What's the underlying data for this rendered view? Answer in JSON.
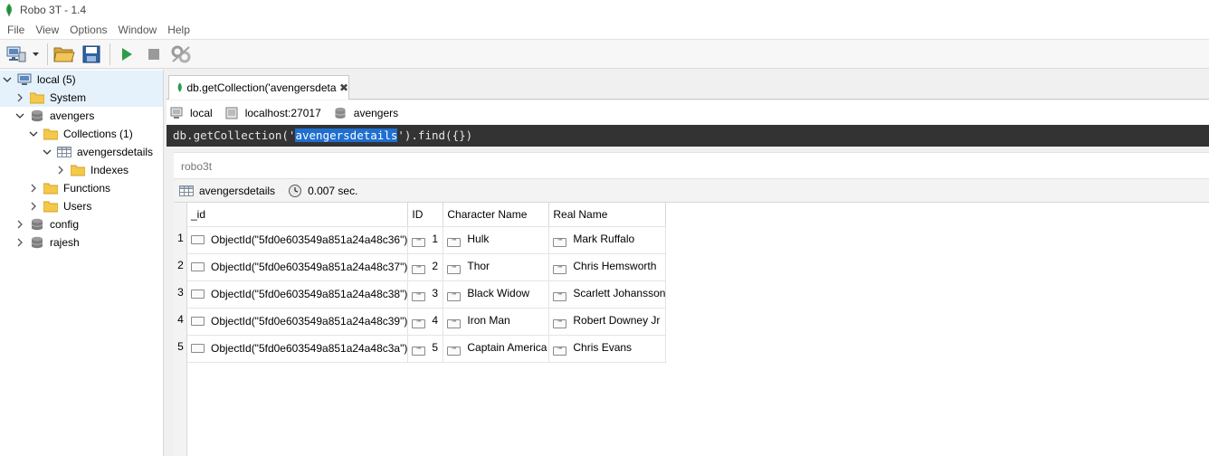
{
  "window": {
    "title": "Robo 3T - 1.4"
  },
  "menu": [
    "File",
    "View",
    "Options",
    "Window",
    "Help"
  ],
  "toolbar": {
    "buttons": [
      "connect-icon",
      "open-folder-icon",
      "save-icon",
      "play-icon",
      "stop-icon",
      "settings-icon"
    ]
  },
  "tree": {
    "connection": "local (5)",
    "items": [
      {
        "label": "System",
        "icon": "folder-icon"
      },
      {
        "label": "avengers",
        "icon": "database-icon"
      },
      {
        "label": "Collections (1)",
        "icon": "folder-icon"
      },
      {
        "label": "avengersdetails",
        "icon": "table-icon"
      },
      {
        "label": "Indexes",
        "icon": "folder-icon"
      },
      {
        "label": "Functions",
        "icon": "folder-icon"
      },
      {
        "label": "Users",
        "icon": "folder-icon"
      },
      {
        "label": "config",
        "icon": "database-icon"
      },
      {
        "label": "rajesh",
        "icon": "database-icon"
      }
    ]
  },
  "tab": {
    "label": "db.getCollection('avengersdetai...",
    "close": "✖"
  },
  "connection_bar": {
    "server": "local",
    "host": "localhost:27017",
    "database": "avengers"
  },
  "query": {
    "prefix": "db.getCollection('",
    "highlight": "avengersdetails",
    "suffix": "').find({})"
  },
  "result": {
    "title": "robo3t",
    "collection": "avengersdetails",
    "time": "0.007 sec."
  },
  "grid": {
    "columns": [
      "_id",
      "ID",
      "Character Name",
      "Real Name"
    ],
    "type_badge": "\"\"",
    "rows": [
      {
        "n": "1",
        "id": "ObjectId(\"5fd0e603549a851a24a48c36\")",
        "ID": "1",
        "character": "Hulk",
        "real": "Mark Ruffalo"
      },
      {
        "n": "2",
        "id": "ObjectId(\"5fd0e603549a851a24a48c37\")",
        "ID": "2",
        "character": "Thor",
        "real": "Chris Hemsworth"
      },
      {
        "n": "3",
        "id": "ObjectId(\"5fd0e603549a851a24a48c38\")",
        "ID": "3",
        "character": "Black Widow",
        "real": "Scarlett Johansson"
      },
      {
        "n": "4",
        "id": "ObjectId(\"5fd0e603549a851a24a48c39\")",
        "ID": "4",
        "character": "Iron Man",
        "real": "Robert Downey Jr"
      },
      {
        "n": "5",
        "id": "ObjectId(\"5fd0e603549a851a24a48c3a\")",
        "ID": "5",
        "character": "Captain America",
        "real": "Chris Evans"
      }
    ]
  },
  "colors": {
    "accent_green": "#2e9c4a",
    "selection": "#e5f1fb",
    "query_bg": "#333333",
    "query_highlight": "#1e6fd0",
    "folder": "#f5c84c"
  }
}
